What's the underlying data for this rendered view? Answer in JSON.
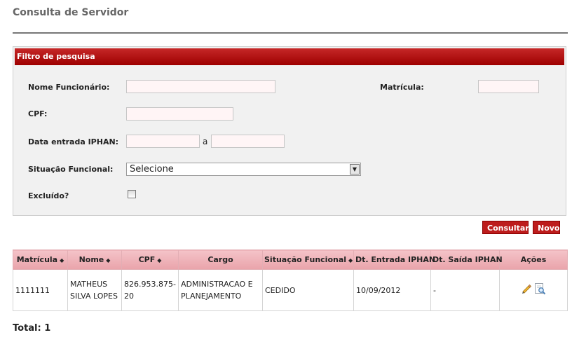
{
  "page": {
    "title": "Consulta de Servidor"
  },
  "filter": {
    "header": "Filtro de pesquisa",
    "nome_label": "Nome Funcionário:",
    "nome_value": "",
    "matricula_label": "Matrícula:",
    "matricula_value": "",
    "cpf_label": "CPF:",
    "cpf_value": "",
    "data_label": "Data entrada IPHAN:",
    "data_from": "",
    "data_sep": "a",
    "data_to": "",
    "situacao_label": "Situação Funcional:",
    "situacao_selected": "Selecione",
    "excluido_label": "Excluído?",
    "excluido_checked": false
  },
  "buttons": {
    "consultar": "Consultar",
    "novo": "Novo"
  },
  "table": {
    "sort_glyph": "◆",
    "columns": {
      "matricula": "Matrícula",
      "nome": "Nome",
      "cpf": "CPF",
      "cargo": "Cargo",
      "situacao": "Situação Funcional",
      "dt_entrada": "Dt. Entrada IPHAN",
      "dt_saida": "Dt. Saída IPHAN",
      "acoes": "Ações"
    },
    "rows": [
      {
        "matricula": "1111111",
        "nome": "MATHEUS SILVA LOPES",
        "cpf": "826.953.875-20",
        "cargo": "ADMINISTRACAO E PLANEJAMENTO",
        "situacao": "CEDIDO",
        "dt_entrada": "10/09/2012",
        "dt_saida": "-",
        "actions": [
          "edit-icon",
          "view-icon"
        ]
      }
    ]
  },
  "footer": {
    "total": "Total: 1"
  },
  "colors": {
    "header_red": "#b00000",
    "button_red": "#bd1c1c",
    "table_header_pink": "#efb4ba"
  }
}
